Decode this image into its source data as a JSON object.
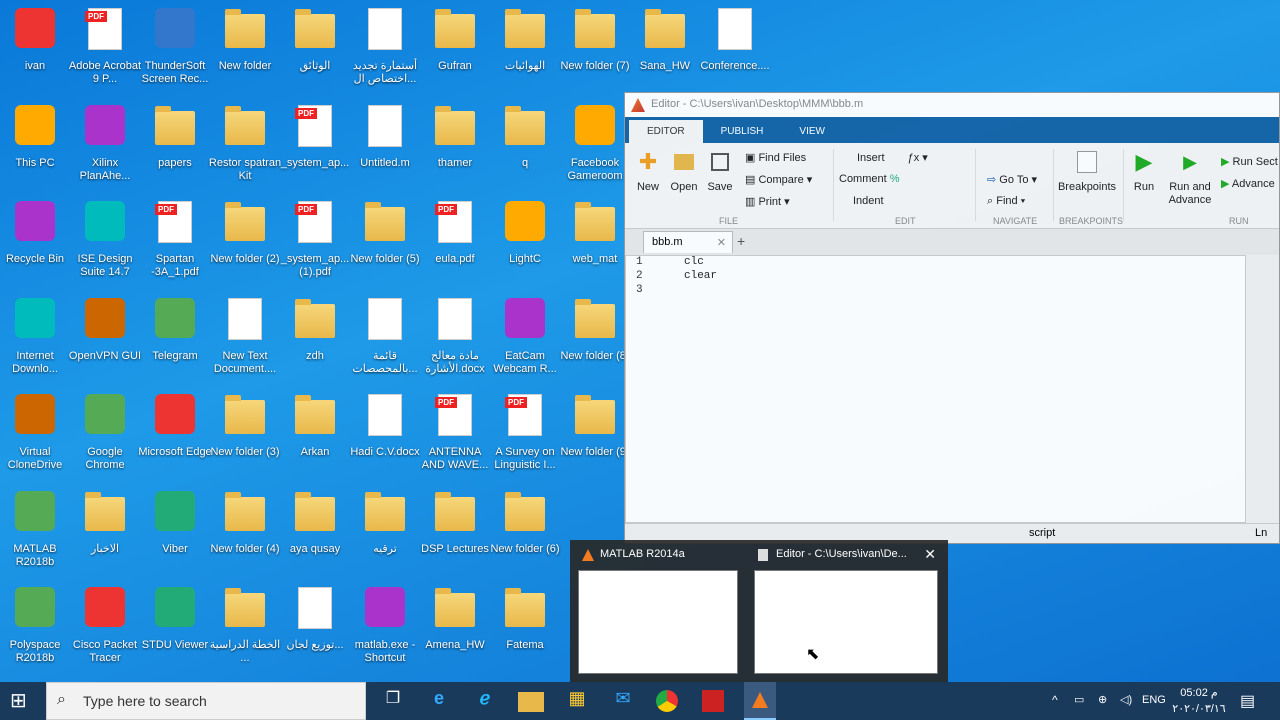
{
  "desktop": {
    "icons": [
      {
        "label": "ivan",
        "type": "user"
      },
      {
        "label": "Adobe Acrobat 9 P...",
        "type": "pdfapp"
      },
      {
        "label": "ThunderSoft Screen Rec...",
        "type": "app"
      },
      {
        "label": "New folder",
        "type": "folder"
      },
      {
        "label": "الوثائق",
        "type": "folder"
      },
      {
        "label": "أستمارة تجديد اختصاص ال...",
        "type": "doc"
      },
      {
        "label": "Gufran",
        "type": "folder"
      },
      {
        "label": "الهوائيات",
        "type": "folder"
      },
      {
        "label": "New folder (7)",
        "type": "folder"
      },
      {
        "label": "Sana_HW",
        "type": "folder"
      },
      {
        "label": "Conference....",
        "type": "doc"
      },
      {
        "label": "This PC",
        "type": "app"
      },
      {
        "label": "Xilinx PlanAhe...",
        "type": "app"
      },
      {
        "label": "papers",
        "type": "folder"
      },
      {
        "label": "Restor spatran Kit",
        "type": "folder"
      },
      {
        "label": "_system_ap...",
        "type": "pdf"
      },
      {
        "label": "Untitled.m",
        "type": "doc"
      },
      {
        "label": "thamer",
        "type": "folder"
      },
      {
        "label": "q",
        "type": "folder"
      },
      {
        "label": "Facebook Gameroom",
        "type": "app"
      },
      {
        "label": "Recycle Bin",
        "type": "app"
      },
      {
        "label": "ISE Design Suite 14.7",
        "type": "app"
      },
      {
        "label": "Spartan -3A_1.pdf",
        "type": "pdf"
      },
      {
        "label": "New folder (2)",
        "type": "folder"
      },
      {
        "label": "_system_ap... (1).pdf",
        "type": "pdf"
      },
      {
        "label": "New folder (5)",
        "type": "folder"
      },
      {
        "label": "eula.pdf",
        "type": "pdf"
      },
      {
        "label": "LightC",
        "type": "app"
      },
      {
        "label": "web_mat",
        "type": "folder"
      },
      {
        "label": "Internet Downlo...",
        "type": "app"
      },
      {
        "label": "OpenVPN GUI",
        "type": "app"
      },
      {
        "label": "Telegram",
        "type": "app"
      },
      {
        "label": "New Text Document....",
        "type": "doc"
      },
      {
        "label": "zdh",
        "type": "folder"
      },
      {
        "label": "قائمة بالمحصصات...",
        "type": "doc"
      },
      {
        "label": "مادة معالج الأشارة.docx",
        "type": "doc"
      },
      {
        "label": "EatCam Webcam R...",
        "type": "app"
      },
      {
        "label": "New folder (8)",
        "type": "folder"
      },
      {
        "label": "Virtual CloneDrive",
        "type": "app"
      },
      {
        "label": "Google Chrome",
        "type": "app"
      },
      {
        "label": "Microsoft Edge",
        "type": "app"
      },
      {
        "label": "New folder (3)",
        "type": "folder"
      },
      {
        "label": "Arkan",
        "type": "folder"
      },
      {
        "label": "Hadi C.V.docx",
        "type": "doc"
      },
      {
        "label": "ANTENNA AND WAVE...",
        "type": "pdf"
      },
      {
        "label": "A Survey on Linguistic I...",
        "type": "pdf"
      },
      {
        "label": "New folder (9)",
        "type": "folder"
      },
      {
        "label": "MATLAB R2018b",
        "type": "app"
      },
      {
        "label": "الاخبار",
        "type": "folder"
      },
      {
        "label": "Viber",
        "type": "app"
      },
      {
        "label": "New folder (4)",
        "type": "folder"
      },
      {
        "label": "aya qusay",
        "type": "folder"
      },
      {
        "label": "ترقيه",
        "type": "folder"
      },
      {
        "label": "DSP Lectures",
        "type": "folder"
      },
      {
        "label": "New folder (6)",
        "type": "folder"
      },
      {
        "label": "Polyspace R2018b",
        "type": "app"
      },
      {
        "label": "Cisco Packet Tracer",
        "type": "app"
      },
      {
        "label": "STDU Viewer",
        "type": "app"
      },
      {
        "label": "الخطة الدراسية ...",
        "type": "folder"
      },
      {
        "label": "توزيع لجان...",
        "type": "doc"
      },
      {
        "label": "matlab.exe - Shortcut",
        "type": "app"
      },
      {
        "label": "Amena_HW",
        "type": "folder"
      },
      {
        "label": "Fatema",
        "type": "folder"
      }
    ]
  },
  "editor": {
    "title": "Editor - C:\\Users\\ivan\\Desktop\\MMM\\bbb.m",
    "tabs": [
      "EDITOR",
      "PUBLISH",
      "VIEW"
    ],
    "ribbon": {
      "new": "New",
      "open": "Open",
      "save": "Save",
      "find_files": "Find Files",
      "compare": "Compare",
      "print": "Print",
      "insert": "Insert",
      "comment": "Comment",
      "indent": "Indent",
      "go_to": "Go To",
      "find": "Find",
      "breakpoints": "Breakpoints",
      "run": "Run",
      "run_advance": "Run and Advance",
      "run_section": "Run Sect",
      "advance": "Advance",
      "group_file": "FILE",
      "group_edit": "EDIT",
      "group_navigate": "NAVIGATE",
      "group_breakpoints": "BREAKPOINTS",
      "group_run": "RUN"
    },
    "file_tab": "bbb.m",
    "lines": [
      {
        "n": "1",
        "text": "clc"
      },
      {
        "n": "2",
        "text": "clear"
      },
      {
        "n": "3",
        "text": ""
      }
    ],
    "status_mode": "script",
    "status_ln": "Ln"
  },
  "preview": {
    "items": [
      {
        "title": "MATLAB R2014a"
      },
      {
        "title": "Editor - C:\\Users\\ivan\\De..."
      }
    ]
  },
  "taskbar": {
    "search_placeholder": "Type here to search",
    "lang": "ENG",
    "time": "05:02 م",
    "date": "٢٠٢٠/٠٣/١٦"
  }
}
